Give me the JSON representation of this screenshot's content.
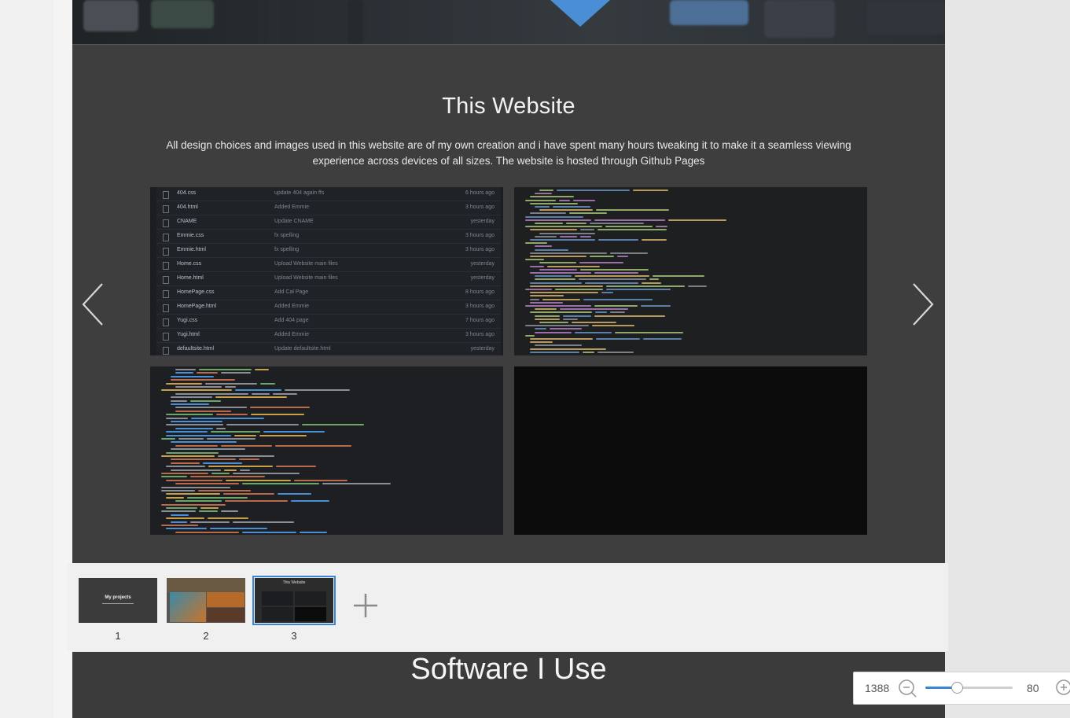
{
  "slide": {
    "title": "This Website",
    "description": "All design choices and images used in this website are of my own creation and i have spent many hours tweaking it to make it a seamless viewing experience across devices of all sizes. The website is hosted through Github Pages",
    "indicator_count": 3,
    "repo_files": [
      {
        "name": "404.css",
        "msg": "update 404 again ffs",
        "time": "6 hours ago"
      },
      {
        "name": "404.html",
        "msg": "Added Emmie",
        "time": "3 hours ago"
      },
      {
        "name": "CNAME",
        "msg": "Update CNAME",
        "time": "yesterday"
      },
      {
        "name": "Emmie.css",
        "msg": "fx spelling",
        "time": "3 hours ago"
      },
      {
        "name": "Emmie.html",
        "msg": "fx spelling",
        "time": "3 hours ago"
      },
      {
        "name": "Home.css",
        "msg": "Upload Website main files",
        "time": "yesterday"
      },
      {
        "name": "Home.html",
        "msg": "Upload Website main files",
        "time": "yesterday"
      },
      {
        "name": "HomePage.css",
        "msg": "Add Cal Page",
        "time": "8 hours ago"
      },
      {
        "name": "HomePage.html",
        "msg": "Added Emmie",
        "time": "3 hours ago"
      },
      {
        "name": "Yugi.css",
        "msg": "Add 404 page",
        "time": "7 hours ago"
      },
      {
        "name": "Yugi.html",
        "msg": "Added Emmie",
        "time": "3 hours ago"
      },
      {
        "name": "defaultsite.html",
        "msg": "Update defaultsite.html",
        "time": "yesterday"
      }
    ]
  },
  "thumbnails": [
    {
      "number": "1",
      "label": "My projects"
    },
    {
      "number": "2",
      "label": ""
    },
    {
      "number": "3",
      "label": "This Website"
    }
  ],
  "next_section": {
    "title": "Software I Use"
  },
  "zoom": {
    "value": "1388",
    "percent": "80",
    "level": 0.36
  },
  "colors": {
    "accent": "#3a86d8",
    "slide_bg": "#3e3e3e",
    "triangle": "#4a8fd6"
  }
}
